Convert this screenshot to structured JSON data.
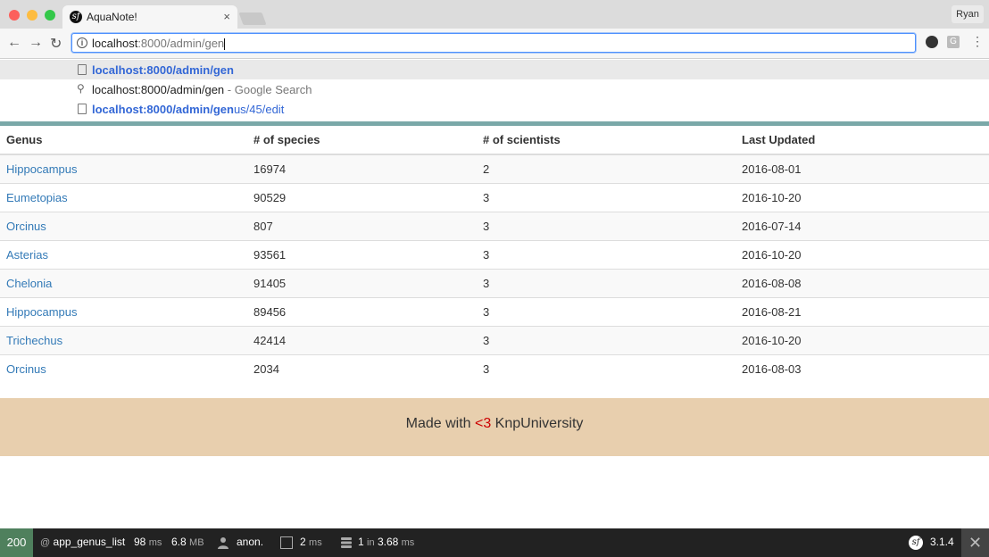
{
  "browser": {
    "tab_title": "AquaNote!",
    "tab_close": "×",
    "profile_name": "Ryan",
    "address": {
      "typed": "localhost",
      "rest": ":8000/admin/gen"
    },
    "menu_glyph": "⋮",
    "ext2_label": "G"
  },
  "suggestions": [
    {
      "bold": "localhost:8000/admin/gen",
      "rest": "",
      "suffix": ""
    },
    {
      "bold": "",
      "rest": "localhost:8000/admin/gen",
      "suffix": " - Google Search"
    },
    {
      "bold": "localhost:8000/admin/gen",
      "rest": "us/45/edit",
      "suffix": ""
    }
  ],
  "table": {
    "headers": [
      "Genus",
      "# of species",
      "# of scientists",
      "Last Updated"
    ],
    "rows": [
      [
        "Hippocampus",
        "16974",
        "2",
        "2016-08-01"
      ],
      [
        "Eumetopias",
        "90529",
        "3",
        "2016-10-20"
      ],
      [
        "Orcinus",
        "807",
        "3",
        "2016-07-14"
      ],
      [
        "Asterias",
        "93561",
        "3",
        "2016-10-20"
      ],
      [
        "Chelonia",
        "91405",
        "3",
        "2016-08-08"
      ],
      [
        "Hippocampus",
        "89456",
        "3",
        "2016-08-21"
      ],
      [
        "Trichechus",
        "42414",
        "3",
        "2016-10-20"
      ],
      [
        "Orcinus",
        "2034",
        "3",
        "2016-08-03"
      ]
    ]
  },
  "footer": {
    "pre": "Made with ",
    "heart": "<3",
    "post": " KnpUniversity"
  },
  "debug_bar": {
    "status": "200",
    "route_prefix": "@",
    "route": "app_genus_list",
    "time_value": "98",
    "time_unit": "ms",
    "memory_value": "6.8",
    "memory_unit": "MB",
    "user": "anon.",
    "forms_value": "2",
    "forms_unit": "ms",
    "db_count": "1",
    "db_in": "in",
    "db_time": "3.68",
    "db_unit": "ms",
    "version": "3.1.4",
    "close": "✕"
  },
  "colors": {
    "status_ok": "#4f805d",
    "link": "#337ab7",
    "footer_bg": "#e8cfae",
    "heart": "#cc0000"
  }
}
